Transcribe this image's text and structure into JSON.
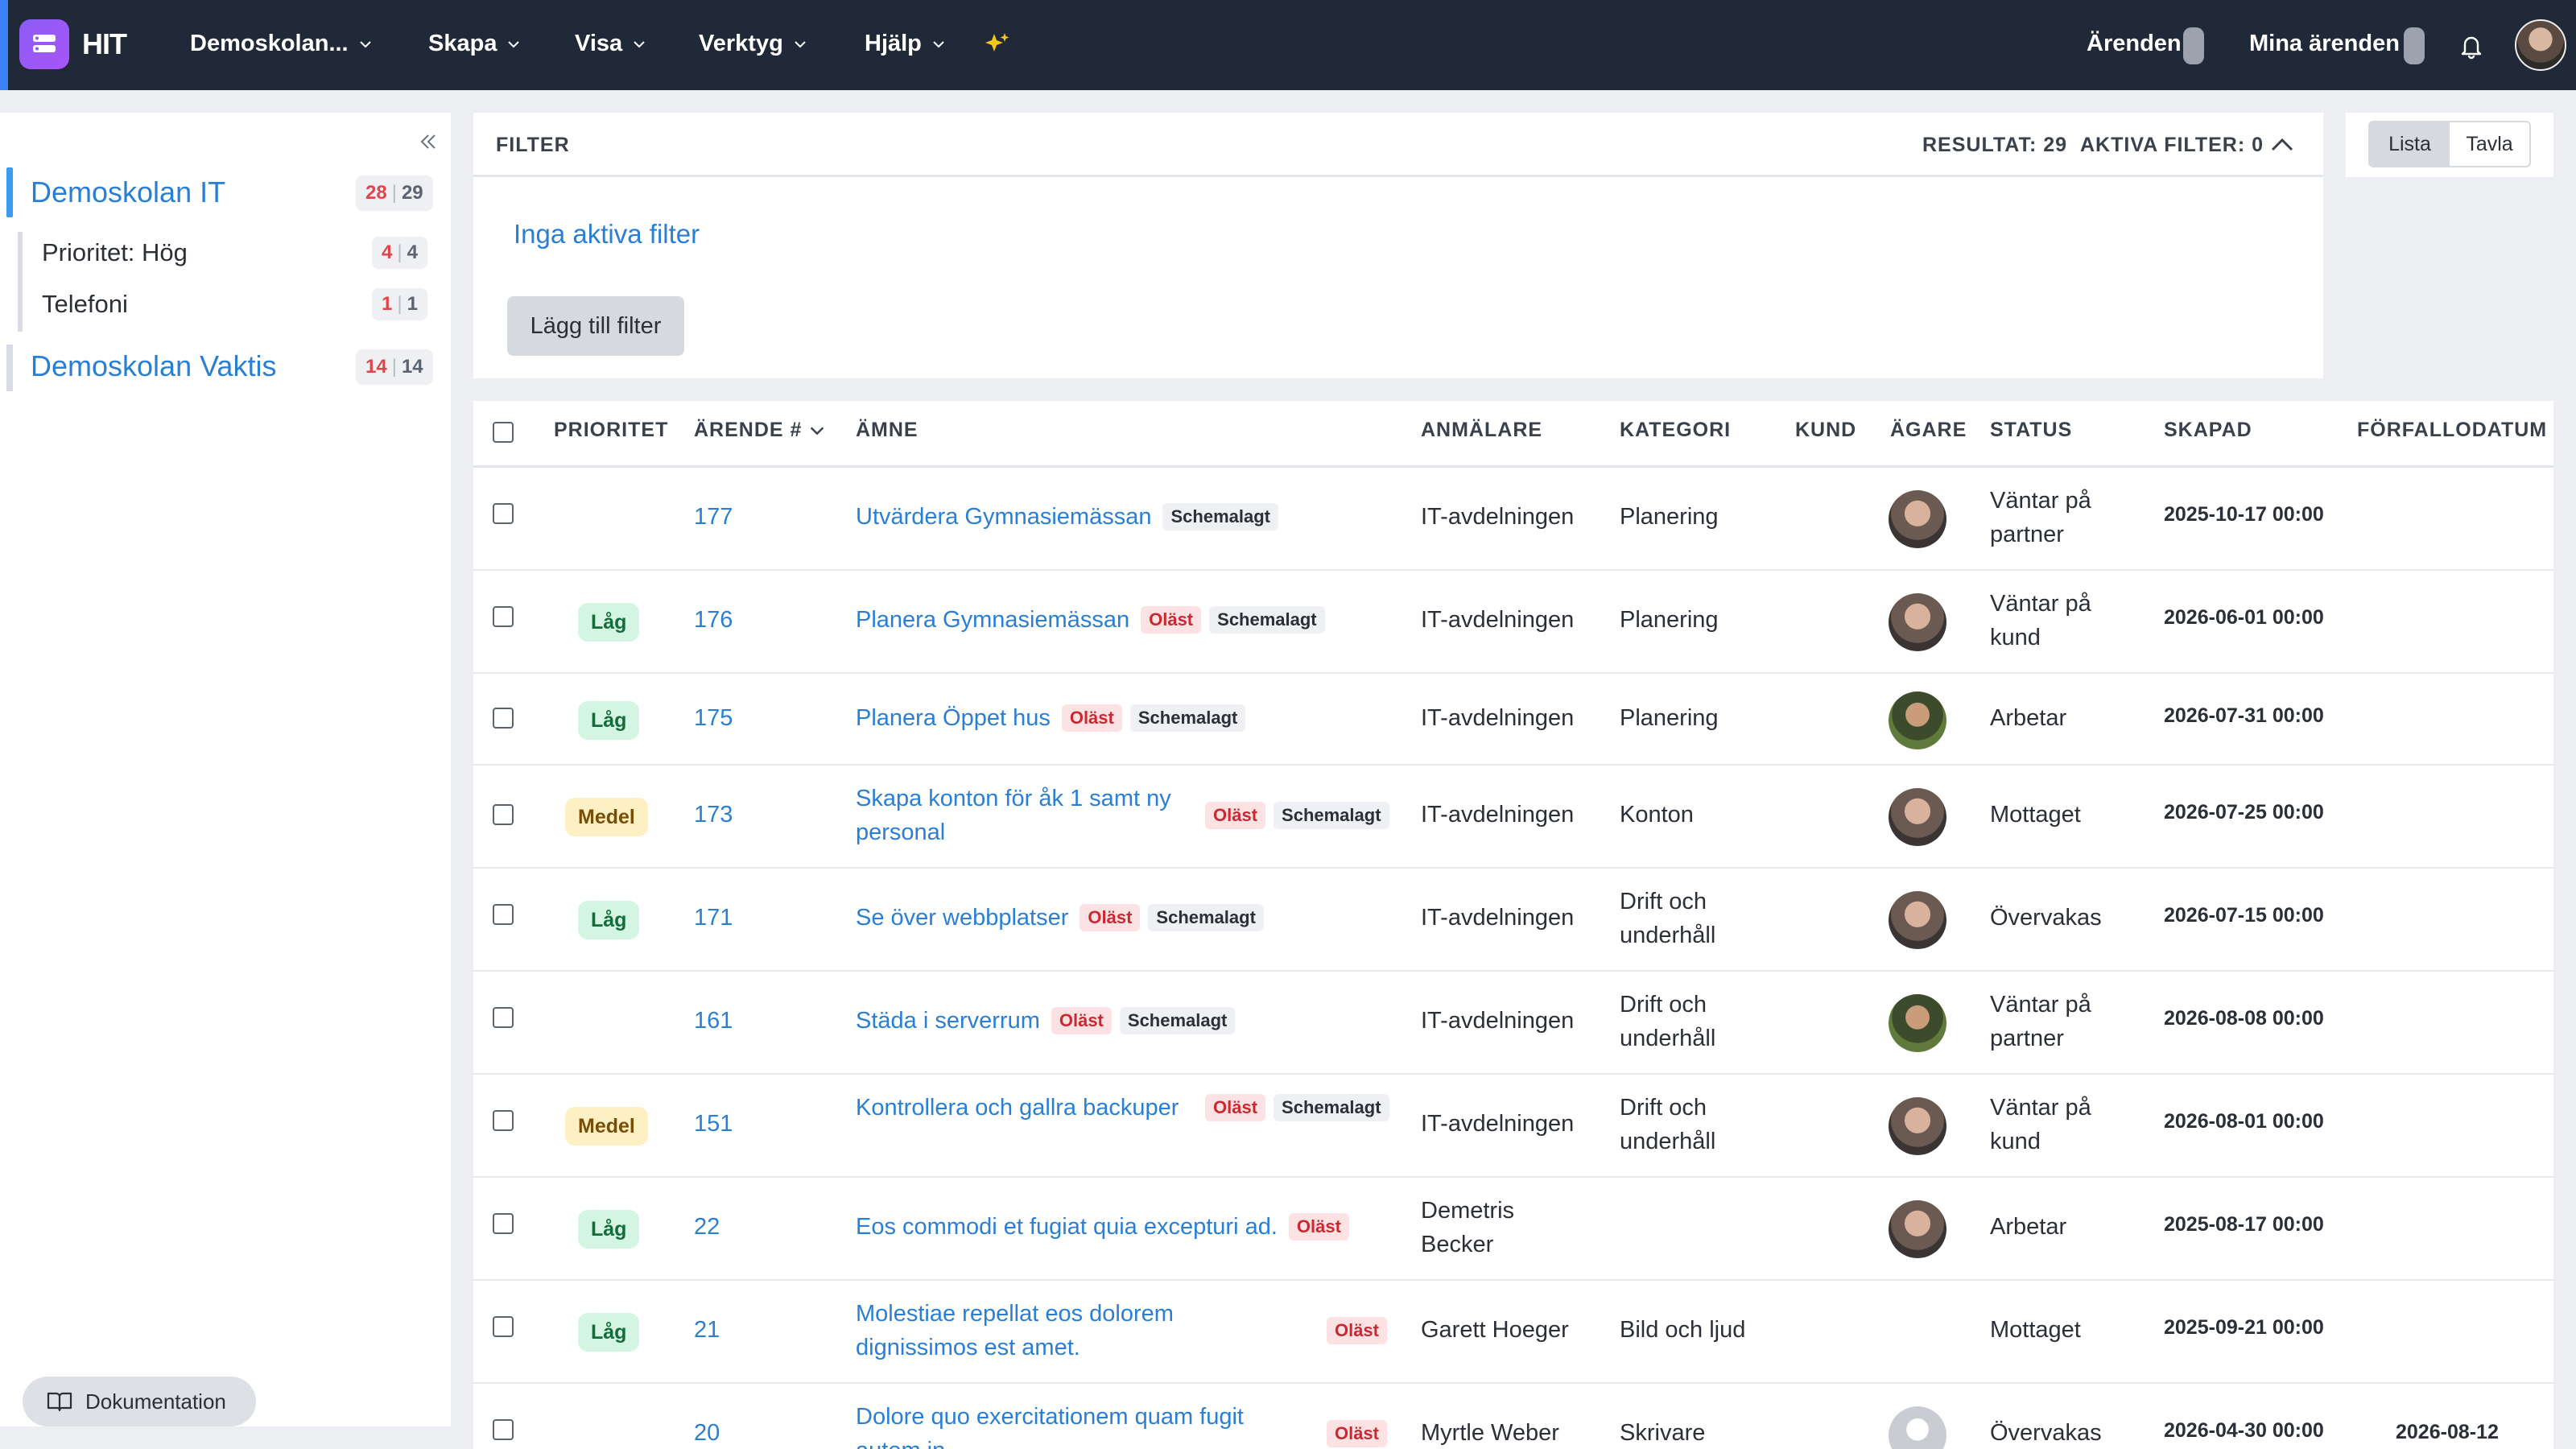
{
  "nav": {
    "brand": "HIT",
    "items": [
      {
        "label": "Demoskolan..."
      },
      {
        "label": "Skapa"
      },
      {
        "label": "Visa"
      },
      {
        "label": "Verktyg"
      },
      {
        "label": "Hjälp"
      }
    ],
    "right": {
      "arenden": "Ärenden",
      "mina_arenden": "Mina ärenden"
    }
  },
  "sidebar": {
    "groups": [
      {
        "title": "Demoskolan IT",
        "unread": "28",
        "total": "29",
        "subs": [
          {
            "label": "Prioritet: Hög",
            "unread": "4",
            "total": "4"
          },
          {
            "label": "Telefoni",
            "unread": "1",
            "total": "1"
          }
        ]
      },
      {
        "title": "Demoskolan Vaktis",
        "unread": "14",
        "total": "14",
        "subs": []
      }
    ],
    "doc_button": "Dokumentation"
  },
  "filter": {
    "title": "FILTER",
    "result": "RESULTAT: 29",
    "active": "AKTIVA FILTER: 0",
    "empty_text": "Inga aktiva filter",
    "add_button": "Lägg till filter"
  },
  "view": {
    "list": "Lista",
    "board": "Tavla"
  },
  "table": {
    "headers": {
      "priority": "PRIORITET",
      "ticket": "ÄRENDE #",
      "subject": "ÄMNE",
      "reporter": "ANMÄLARE",
      "category": "KATEGORI",
      "customer": "KUND",
      "owner": "ÄGARE",
      "status": "STATUS",
      "created": "SKAPAD",
      "due": "FÖRFALLODATUM"
    },
    "tags": {
      "unread": "Oläst",
      "scheduled": "Schemalagt"
    },
    "rows": [
      {
        "priority": "",
        "id": "177",
        "subject": "Utvärdera Gymnasiemässan",
        "unread": "",
        "scheduled": "Schemalagt",
        "reporter": "IT-avdelningen",
        "category": "Planering",
        "status": "Väntar på partner",
        "created": "2025-10-17 00:00",
        "due": ""
      },
      {
        "priority": "Låg",
        "id": "176",
        "subject": "Planera Gymnasiemässan",
        "unread": "Oläst",
        "scheduled": "Schemalagt",
        "reporter": "IT-avdelningen",
        "category": "Planering",
        "status": "Väntar på kund",
        "created": "2026-06-01 00:00",
        "due": ""
      },
      {
        "priority": "Låg",
        "id": "175",
        "subject": "Planera Öppet hus",
        "unread": "Oläst",
        "scheduled": "Schemalagt",
        "reporter": "IT-avdelningen",
        "category": "Planering",
        "status": "Arbetar",
        "created": "2026-07-31 00:00",
        "due": ""
      },
      {
        "priority": "Medel",
        "id": "173",
        "subject": "Skapa konton för åk 1 samt ny personal",
        "unread": "Oläst",
        "scheduled": "Schemalagt",
        "reporter": "IT-avdelningen",
        "category": "Konton",
        "status": "Mottaget",
        "created": "2026-07-25 00:00",
        "due": ""
      },
      {
        "priority": "Låg",
        "id": "171",
        "subject": "Se över webbplatser",
        "unread": "Oläst",
        "scheduled": "Schemalagt",
        "reporter": "IT-avdelningen",
        "category": "Drift och underhåll",
        "status": "Övervakas",
        "created": "2026-07-15 00:00",
        "due": ""
      },
      {
        "priority": "",
        "id": "161",
        "subject": "Städa i serverrum",
        "unread": "Oläst",
        "scheduled": "Schemalagt",
        "reporter": "IT-avdelningen",
        "category": "Drift och underhåll",
        "status": "Väntar på partner",
        "created": "2026-08-08 00:00",
        "due": ""
      },
      {
        "priority": "Medel",
        "id": "151",
        "subject": "Kontrollera och gallra backuper",
        "unread": "Oläst",
        "scheduled": "Schemalagt",
        "reporter": "IT-avdelningen",
        "category": "Drift och underhåll",
        "status": "Väntar på kund",
        "created": "2026-08-01 00:00",
        "due": ""
      },
      {
        "priority": "Låg",
        "id": "22",
        "subject": "Eos commodi et fugiat quia excepturi ad.",
        "unread": "Oläst",
        "scheduled": "",
        "reporter": "Demetris Becker",
        "category": "",
        "status": "Arbetar",
        "created": "2025-08-17 00:00",
        "due": ""
      },
      {
        "priority": "Låg",
        "id": "21",
        "subject": "Molestiae repellat eos dolorem dignissimos est amet.",
        "unread": "Oläst",
        "scheduled": "",
        "reporter": "Garett Hoeger",
        "category": "Bild och ljud",
        "status": "Mottaget",
        "created": "2025-09-21 00:00",
        "due": ""
      },
      {
        "priority": "",
        "id": "20",
        "subject": "Dolore quo exercitationem quam fugit autem in.",
        "unread": "Oläst",
        "scheduled": "",
        "reporter": "Myrtle Weber",
        "category": "Skrivare",
        "status": "Övervakas",
        "created": "2026-04-30 00:00",
        "due": "2026-08-12"
      }
    ]
  },
  "colors": {
    "topbar": "#1f2937",
    "link": "#2a7fd4",
    "accent": "#8b5cf6",
    "unread": "#e0454b"
  }
}
